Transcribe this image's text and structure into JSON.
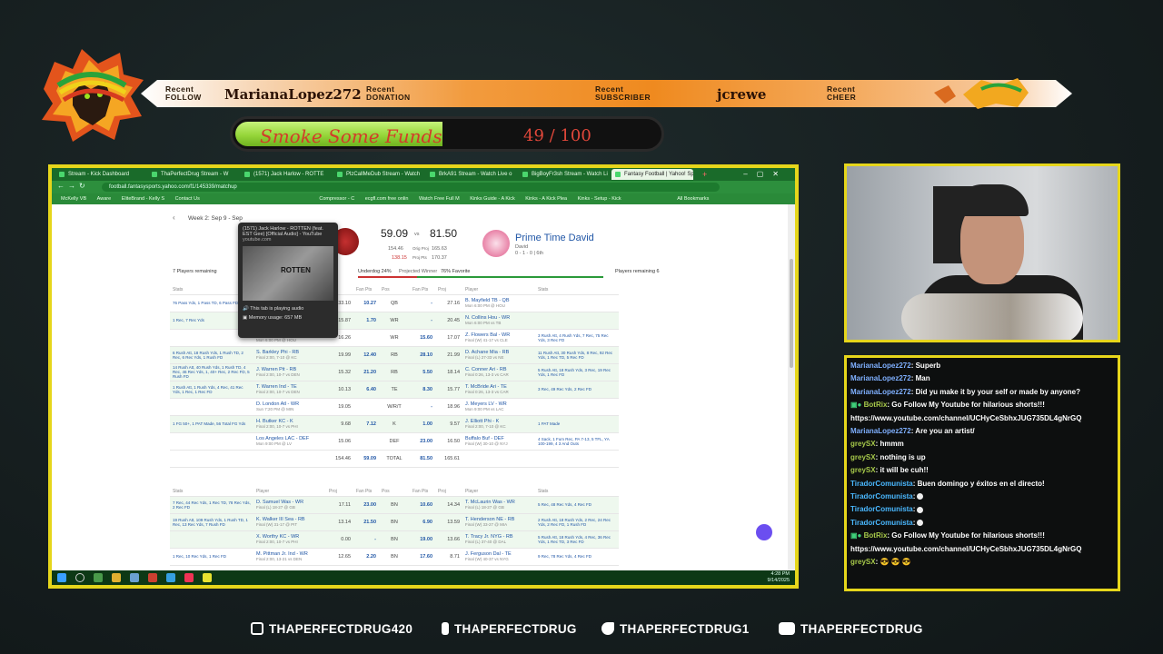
{
  "ribbon": {
    "follow_label": "Recent\nFOLLOW",
    "follow_value": "MarianaLopez272",
    "donation_label": "Recent\nDONATION",
    "donation_value": "",
    "subscriber_label": "Recent\nSUBSCRIBER",
    "subscriber_value": "jcrewe",
    "cheer_label": "Recent\nCHEER",
    "cheer_value": ""
  },
  "goal": {
    "title": "Smoke Some Funds",
    "current": 49,
    "target": 100,
    "display": "49 / 100"
  },
  "browser": {
    "tabs": [
      "Stream - Kick Dashboard",
      "ThaPerfectDrug Stream - W",
      "(1571) Jack Harlow - ROTTE",
      "PlzCallMeDub Stream - Watch",
      "BrkA91 Stream - Watch Live o",
      "BigBoyFr3sh Stream - Watch Li",
      "Fantasy Football | Yahoo! Sport"
    ],
    "url": "football.fantasysports.yahoo.com/f1/145339/matchup",
    "bookmarks": [
      "McKelly VB",
      "Aware",
      "EliteBrand - Kelly S",
      "Contact Us",
      "Compressor - C",
      "ecgfl.com free onlin",
      "Watch Free Full M",
      "Kinks Guide - A Kick",
      "Kinks - A Kick Plea",
      "Kinks - Setup - Kick",
      "All Bookmarks"
    ]
  },
  "popup": {
    "title": "(1571) Jack Harlow - ROTTEN (feat. EST Gee) [Official Audio] - YouTube",
    "site": "youtube.com",
    "thumb_text": "ROTTEN",
    "audio": "This tab is playing audio",
    "memory": "Memory usage: 657 MB"
  },
  "matchup": {
    "week": "Week 2: Sep 9 - Sep",
    "score_left": "59.09",
    "vs": "vs",
    "score_right": "81.50",
    "proj_left": "154.46",
    "proj_left_label": "Orig Proj",
    "proj_right": "165.63",
    "proj_left2": "138.15",
    "proj_label2": "Proj Pts",
    "proj_right2": "170.37",
    "team2_name": "Prime Time David",
    "team2_owner": "David",
    "team2_record": "0 - 1 - 0 | 6th",
    "left_remaining": "7 Players remaining",
    "underdog": "Underdog 24%",
    "projected": "Projected Winner",
    "favorite": "76% Favorite",
    "right_remaining": "Players remaining 6",
    "headers": [
      "Stats",
      "Player",
      "Proj",
      "Fan Pts",
      "Pos",
      "Fan Pts",
      "Proj",
      "Player",
      "Stats"
    ],
    "rows": [
      {
        "ls": "76 Pass Yds, 1 Pass TD, 6 Pass FD",
        "lp": "J. Burrow Cin - QB",
        "ld": "Final (W) 31-27 vs JAX",
        "lpr": "33.10",
        "lf": "10.27",
        "pos": "QB",
        "rf": "-",
        "rpr": "27.16",
        "rp": "B. Mayfield TB - QB",
        "rd": "Mon 6:00 PM @ HOU",
        "rs": ""
      },
      {
        "ls": "1 Rec, 7 Rec Yds",
        "lp": "A.J. Brown Phi - WR",
        "ld": "Final 2:00, 7-10 @ KC",
        "lpr": "15.87",
        "lf": "1.70",
        "pos": "WR",
        "rf": "-",
        "rpr": "20.45",
        "rp": "N. Collins Hou - WR",
        "rd": "Mon 6:00 PM vs TB",
        "rs": ""
      },
      {
        "ls": "",
        "lp": "E. Egbuka TB - WR",
        "ld": "Mon 6:00 PM @ HOU",
        "lpr": "16.26",
        "lf": "",
        "pos": "WR",
        "rf": "15.60",
        "rpr": "17.07",
        "rp": "Z. Flowers Bal - WR",
        "rd": "Final (W) 41-17 vs CLE",
        "rs": "3 Rush Att, 4 Rush Yds, 7 Rec, 75 Rec Yds, 3 Rec FD"
      },
      {
        "ls": "6 Rush Att, 18 Rush Yds, 1 Rush TD, 2 Rec, 6 Rec Yds, 1 Rush FD",
        "lp": "S. Barkley Phi - RB",
        "ld": "Final 2:00, 7-10 @ KC",
        "lpr": "19.99",
        "lf": "12.40",
        "pos": "RB",
        "rf": "28.10",
        "rpr": "21.99",
        "rp": "D. Achane Mia - RB",
        "rd": "Final (L) 27-33 vs NE",
        "rs": "11 Rush Att, 30 Rush Yds, 8 Rec, 92 Rec Yds, 1 Rec TD, 5 Rec FD"
      },
      {
        "ls": "14 Rush Att, 40 Rush Yds, 1 Rush TD, 4 Rec, 46 Rec Yds, 1, 40+ Rec, 2 Rec FD, 5 Rush FD",
        "lp": "J. Warren Pit - RB",
        "ld": "Final 2:00, 10-7 vs DEN",
        "lpr": "15.32",
        "lf": "21.20",
        "pos": "RB",
        "rf": "5.50",
        "rpr": "18.14",
        "rp": "C. Conner Ari - RB",
        "rd": "Final 0:26, 13-3 vs CAR",
        "rs": "5 Rush Att, 18 Rush Yds, 3 Rec, 19 Rec Yds, 1 Rec FD"
      },
      {
        "ls": "1 Rush Att, 1 Rush Yds, 4 Rec, 41 Rec Yds, 1 Rec, 1 Rec FD",
        "lp": "T. Warren Ind - TE",
        "ld": "Final 2:00, 10-7 vs DEN",
        "lpr": "10.13",
        "lf": "6.40",
        "pos": "TE",
        "rf": "8.30",
        "rpr": "15.77",
        "rp": "T. McBride Ari - TE",
        "rd": "Final 0:26, 13-3 vs CAR",
        "rs": "3 Rec, 49 Rec Yds, 2 Rec FD"
      },
      {
        "ls": "",
        "lp": "D. London Atl - WR",
        "ld": "Sun 7:20 PM @ MIN",
        "lpr": "19.05",
        "lf": "",
        "pos": "W/R/T",
        "rf": "-",
        "rpr": "18.96",
        "rp": "J. Meyers LV - WR",
        "rd": "Mon 9:00 PM vs LAC",
        "rs": ""
      },
      {
        "ls": "1 FG 50+, 1 PAT Made, 56 Total FG Yds",
        "lp": "H. Butker KC - K",
        "ld": "Final 2:00, 10-7 vs PHI",
        "lpr": "9.68",
        "lf": "7.12",
        "pos": "K",
        "rf": "1.00",
        "rpr": "9.57",
        "rp": "J. Elliott Phi - K",
        "rd": "Final 2:00, 7-10 @ KC",
        "rs": "1 PAT Made"
      },
      {
        "ls": "",
        "lp": "Los Angeles LAC - DEF",
        "ld": "Mon 9:00 PM @ LV",
        "lpr": "15.06",
        "lf": "",
        "pos": "DEF",
        "rf": "23.00",
        "rpr": "16.50",
        "rp": "Buffalo Buf - DEF",
        "rd": "Final (W) 30-10 @ NYJ",
        "rs": "4 Sack, 1 Fum Rec, PA 7-13, 5 TFL, YA 100-199, 4 3 And Outs"
      }
    ],
    "totals": {
      "lpr": "154.46",
      "lf": "59.09",
      "label": "TOTAL",
      "rf": "81.50",
      "rpr": "165.61"
    },
    "bench": [
      {
        "ls": "7 Rec, 44 Rec Yds, 1 Rec TD, 78 Rec Yds, 2 Rec FD",
        "lp": "D. Samuel Was - WR",
        "ld": "Final (L) 18-27 @ GB",
        "lpr": "17.11",
        "lf": "23.00",
        "pos": "BN",
        "rf": "10.60",
        "rpr": "14.34",
        "rp": "T. McLaurin Was - WR",
        "rd": "Final (L) 18-27 @ GB",
        "rs": "5 Rec, 48 Rec Yds, 4 Rec FD"
      },
      {
        "ls": "19 Rush Att, 109 Rush Yds, 1 Rush TD, 1 Rec, 13 Rec Yds, 7 Rush FD",
        "lp": "K. Walker III Sea - RB",
        "ld": "Final (W) 31-17 @ PIT",
        "lpr": "13.14",
        "lf": "21.50",
        "pos": "BN",
        "rf": "6.90",
        "rpr": "13.59",
        "rp": "T. Henderson NE - RB",
        "rd": "Final (W) 33-27 @ MIA",
        "rs": "2 Rush Att, 18 Rush Yds, 2 Rec, 24 Rec Yds, 2 Rec FD, 1 Rush FD"
      },
      {
        "ls": "",
        "lp": "X. Worthy KC - WR",
        "ld": "Final 2:00, 10-7 vs PHI",
        "lpr": "0.00",
        "lf": "-",
        "pos": "BN",
        "rf": "19.00",
        "rpr": "13.66",
        "rp": "T. Tracy Jr. NYG - RB",
        "rd": "Final (L) 37-40 @ DAL",
        "rs": "5 Rush Att, 18 Rush Yds, 4 Rec, 36 Rec Yds, 1 Rec TD, 3 Rec FD"
      },
      {
        "ls": "1 Rec, 10 Rec Yds, 1 Rec FD",
        "lp": "M. Pittman Jr. Ind - WR",
        "ld": "Final 2:00, 13-21 vs DEN",
        "lpr": "12.65",
        "lf": "2.20",
        "pos": "BN",
        "rf": "17.60",
        "rpr": "8.71",
        "rp": "J. Ferguson Dal - TE",
        "rd": "Final (W) 40-37 vs NYG",
        "rs": "9 Rec, 78 Rec Yds, 4 Rec FD"
      }
    ],
    "clock_time": "4:28 PM",
    "clock_date": "9/14/2025"
  },
  "chat": [
    {
      "user": "MarianaLopez272",
      "cls": "u1",
      "text": ": Superb"
    },
    {
      "user": "MarianaLopez272",
      "cls": "u1",
      "text": ": Man"
    },
    {
      "user": "MarianaLopez272",
      "cls": "u1",
      "text": ": Did yu make it by your self or made by anyone?"
    },
    {
      "user": "BotRix",
      "cls": "u2",
      "text": ": Go Follow My Youtube for hilarious shorts!!!"
    },
    {
      "user": "",
      "cls": "",
      "text": "https://www.youtube.com/channel/UCHyCeSbhxJUG735DL4gNrGQ"
    },
    {
      "user": "MarianaLopez272",
      "cls": "u1",
      "text": ": Are you an artist/"
    },
    {
      "user": "greySX",
      "cls": "u2",
      "text": ": hmmm"
    },
    {
      "user": "greySX",
      "cls": "u2",
      "text": ": nothing is up"
    },
    {
      "user": "greySX",
      "cls": "u2",
      "text": ": it will be cuh!!"
    },
    {
      "user": "TiradorComunista",
      "cls": "u3",
      "text": ": Buen domingo y éxitos en el directo!"
    },
    {
      "user": "TiradorComunista",
      "cls": "u3",
      "text": ":"
    },
    {
      "user": "TiradorComunista",
      "cls": "u3",
      "text": ":"
    },
    {
      "user": "TiradorComunista",
      "cls": "u3",
      "text": ":"
    },
    {
      "user": "BotRix",
      "cls": "u2",
      "text": ": Go Follow My Youtube for hilarious shorts!!!"
    },
    {
      "user": "",
      "cls": "",
      "text": "https://www.youtube.com/channel/UCHyCeSbhxJUG735DL4gNrGQ"
    },
    {
      "user": "greySX",
      "cls": "u2",
      "text": ": 😎 😎 😎"
    }
  ],
  "socials": {
    "instagram": "THAPERFECTDRUG420",
    "facebook": "THAPERFECTDRUG",
    "twitter": "THAPERFECTDRUG1",
    "youtube": "THAPERFECTDRUG"
  },
  "colors": {
    "frame": "#e6d61b",
    "goal_fill": "#96d63a",
    "ribbon": "#ef8a1f",
    "browser_green": "#2d8f3d"
  }
}
